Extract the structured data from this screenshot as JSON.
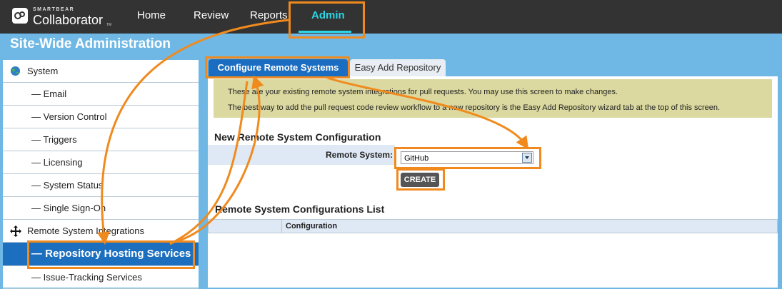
{
  "app": {
    "brand_small": "SMARTBEAR",
    "brand_name": "Collaborator",
    "brand_tm": "TM"
  },
  "nav": {
    "items": [
      {
        "label": "Home"
      },
      {
        "label": "Review"
      },
      {
        "label": "Reports"
      },
      {
        "label": "Admin",
        "active": true
      }
    ]
  },
  "page": {
    "title": "Site-Wide Administration"
  },
  "sidebar": {
    "items": [
      {
        "label": "System",
        "icon": "globe-icon"
      },
      {
        "label": "— Email"
      },
      {
        "label": "— Version Control"
      },
      {
        "label": "— Triggers"
      },
      {
        "label": "— Licensing"
      },
      {
        "label": "— System Status"
      },
      {
        "label": "— Single Sign-On"
      },
      {
        "label": "Remote System Integrations",
        "icon": "move-arrows-icon"
      },
      {
        "label": "— Repository Hosting Services",
        "active": true
      },
      {
        "label": "— Issue-Tracking Services"
      }
    ]
  },
  "tabs": [
    {
      "label": "Configure Remote Systems",
      "active": true
    },
    {
      "label": "Easy Add Repository"
    }
  ],
  "notice": {
    "line1": "These are your existing remote system integrations for pull requests. You may use this screen to make changes.",
    "line2": "The best way to add the pull request code review workflow to a new repository is the Easy Add Repository wizard tab at the top of this screen."
  },
  "new_config": {
    "heading": "New Remote System Configuration",
    "label": "Remote System:",
    "selected": "GitHub",
    "create": "CREATE"
  },
  "list": {
    "heading": "Remote System Configurations List",
    "column": "Configuration"
  },
  "colors": {
    "topbar": "#333333",
    "accent": "#2bd6e6",
    "highlight": "#f08a1e",
    "active_blue": "#1c6fbf",
    "background": "#6fb8e6"
  }
}
